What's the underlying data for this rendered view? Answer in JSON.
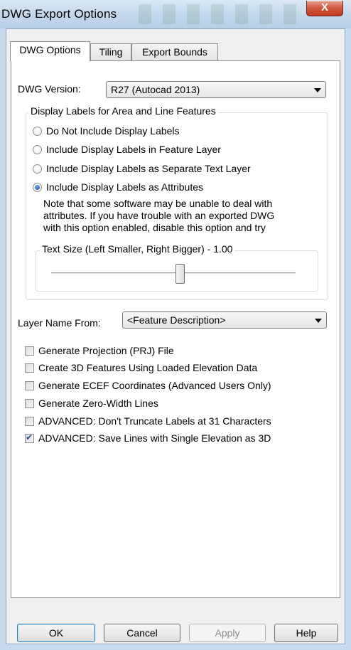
{
  "window": {
    "title": "DWG Export Options",
    "close_glyph": "X"
  },
  "tabs": [
    {
      "label": "DWG Options",
      "active": true
    },
    {
      "label": "Tiling",
      "active": false
    },
    {
      "label": "Export Bounds",
      "active": false
    }
  ],
  "dwg_version": {
    "label": "DWG Version:",
    "selected": "R27 (Autocad 2013)"
  },
  "display_labels": {
    "title": "Display Labels for Area and Line Features",
    "options": [
      {
        "label": "Do Not Include Display Labels",
        "checked": false
      },
      {
        "label": "Include Display Labels in Feature Layer",
        "checked": false
      },
      {
        "label": "Include Display Labels as Separate Text Layer",
        "checked": false
      },
      {
        "label": "Include Display Labels as Attributes",
        "checked": true
      }
    ],
    "note_lines": [
      "Note that some software may be unable to deal with",
      "attributes. If you have trouble with an exported DWG",
      "with this option enabled, disable this option and try"
    ]
  },
  "text_size": {
    "title": "Text Size (Left Smaller, Right Bigger) - 1.00",
    "value": 1.0
  },
  "layer_name": {
    "label": "Layer Name From:",
    "selected": "<Feature Description>"
  },
  "checkboxes": [
    {
      "label": "Generate Projection (PRJ) File",
      "checked": false
    },
    {
      "label": "Create 3D Features Using Loaded Elevation Data",
      "checked": false
    },
    {
      "label": "Generate ECEF Coordinates (Advanced Users Only)",
      "checked": false
    },
    {
      "label": "Generate Zero-Width Lines",
      "checked": false
    },
    {
      "label": "ADVANCED: Don't Truncate Labels at 31 Characters",
      "checked": false
    },
    {
      "label": "ADVANCED: Save Lines with Single Elevation as 3D",
      "checked": true
    }
  ],
  "buttons": {
    "ok": "OK",
    "cancel": "Cancel",
    "apply": "Apply",
    "help": "Help"
  }
}
